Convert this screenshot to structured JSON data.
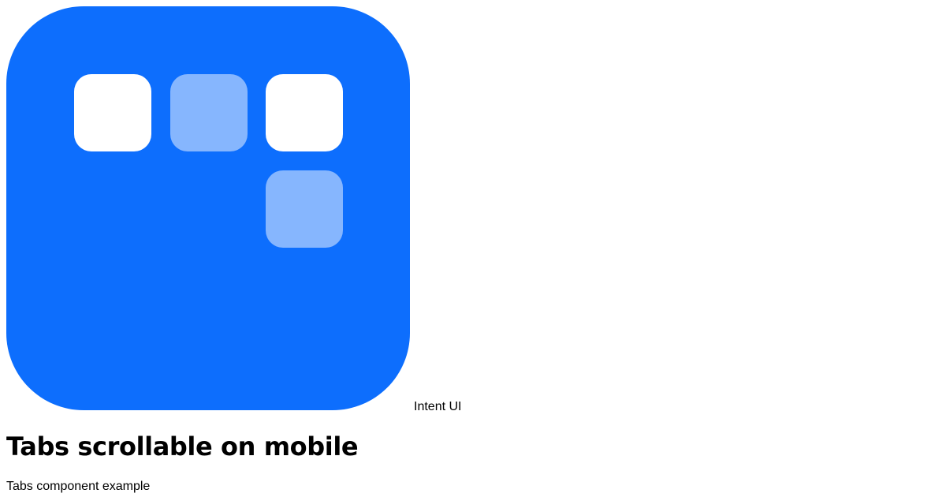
{
  "brand": {
    "name": "Intent UI",
    "logo_icon": "intent-ui-logo-icon",
    "colors": {
      "primary": "#0d6efd",
      "tile_white": "#ffffff",
      "tile_light": "#86b6fe"
    }
  },
  "page": {
    "title": "Tabs scrollable on mobile",
    "subtitle": "Tabs component example"
  }
}
